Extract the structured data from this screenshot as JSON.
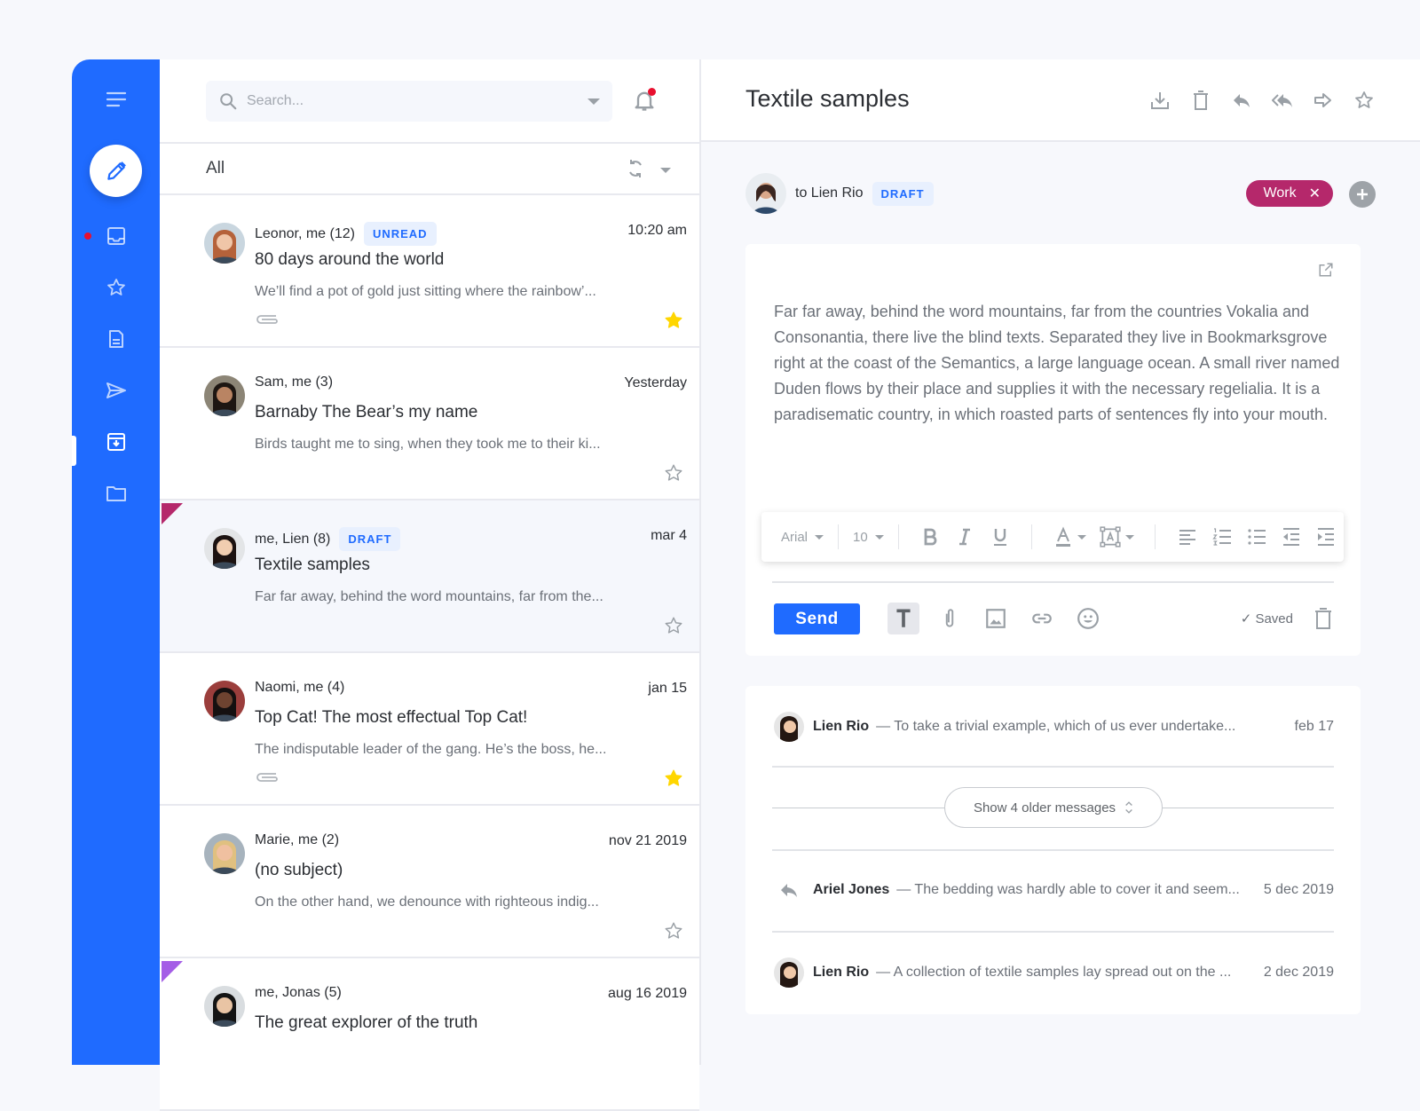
{
  "colors": {
    "brand": "#1f6bff",
    "notification": "#e8102f",
    "tag_work": "#b5286b",
    "flag_magenta": "#b5286b",
    "flag_purple": "#a45de6",
    "star_filled": "#ffd600",
    "badge_bg": "#e8f0fe"
  },
  "sidebar": {
    "items": [
      {
        "icon": "menu-icon",
        "label": "Menu"
      },
      {
        "icon": "pencil-icon",
        "label": "Compose"
      },
      {
        "icon": "inbox-icon",
        "label": "Inbox",
        "has_notification": true
      },
      {
        "icon": "star-icon",
        "label": "Starred"
      },
      {
        "icon": "document-icon",
        "label": "Drafts"
      },
      {
        "icon": "send-icon",
        "label": "Sent"
      },
      {
        "icon": "archive-icon",
        "label": "Archive",
        "active": true
      },
      {
        "icon": "folder-icon",
        "label": "Folders"
      }
    ]
  },
  "list": {
    "search_placeholder": "Search...",
    "filter_label": "All",
    "items": [
      {
        "from": "Leonor, me (12)",
        "badge": "UNREAD",
        "date": "10:20 am",
        "subject": "80 days around the world",
        "preview": "We’ll find a pot of gold just sitting where the rainbow’...",
        "attachment": true,
        "starred": true,
        "flag": null,
        "selected": false
      },
      {
        "from": "Sam, me (3)",
        "badge": null,
        "date": "Yesterday",
        "subject": "Barnaby The Bear’s my name",
        "preview": "Birds taught me to sing, when they took me to their ki...",
        "attachment": false,
        "starred": false,
        "flag": null,
        "selected": false
      },
      {
        "from": "me, Lien (8)",
        "badge": "DRAFT",
        "date": "mar 4",
        "subject": "Textile samples",
        "preview": "Far far away, behind the word mountains, far from the...",
        "attachment": false,
        "starred": false,
        "flag": "magenta",
        "selected": true
      },
      {
        "from": "Naomi, me (4)",
        "badge": null,
        "date": "jan 15",
        "subject": "Top Cat! The most effectual Top Cat!",
        "preview": "The indisputable leader of the gang. He’s the boss, he...",
        "attachment": true,
        "starred": true,
        "flag": null,
        "selected": false
      },
      {
        "from": "Marie, me (2)",
        "badge": null,
        "date": "nov 21 2019",
        "subject": "(no subject)",
        "preview": "On the other hand, we denounce with righteous indig...",
        "attachment": false,
        "starred": false,
        "flag": null,
        "selected": false
      },
      {
        "from": "me, Jonas (5)",
        "badge": null,
        "date": "aug 16 2019",
        "subject": "The great explorer of the truth",
        "preview": "",
        "attachment": false,
        "starred": false,
        "flag": "purple",
        "selected": false
      }
    ]
  },
  "detail": {
    "title": "Textile samples",
    "actions": [
      "download-icon",
      "trash-icon",
      "reply-icon",
      "reply-all-icon",
      "forward-icon",
      "star-icon"
    ],
    "to_prefix": "to",
    "to_name": "Lien Rio",
    "status_badge": "DRAFT",
    "tag": "Work",
    "tag_remove": "✕",
    "body": "Far far away, behind the word mountains, far from the countries Vokalia and Consonantia, there live the blind texts. Separated they live in Bookmarksgrove right at the coast of the Semantics, a large language ocean. A small river named Duden flows by their place and supplies it with the necessary regelialia. It is a paradisematic country, in which roasted parts of sentences fly into your mouth.",
    "format": {
      "font": "Arial",
      "size": "10"
    },
    "send_label": "Send",
    "saved_label": "✓ Saved",
    "thread": [
      {
        "name": "Lien Rio",
        "snippet": "— To take a trivial example, which of us ever undertake...",
        "date": "feb 17",
        "type": "avatar"
      },
      {
        "name": "Ariel Jones",
        "snippet": "— The bedding was hardly able to cover it and seem...",
        "date": "5 dec 2019",
        "type": "reply"
      },
      {
        "name": "Lien Rio",
        "snippet": "— A collection of textile samples lay spread out on the ...",
        "date": "2 dec 2019",
        "type": "avatar"
      }
    ],
    "older_messages_label": "Show 4 older messages"
  }
}
